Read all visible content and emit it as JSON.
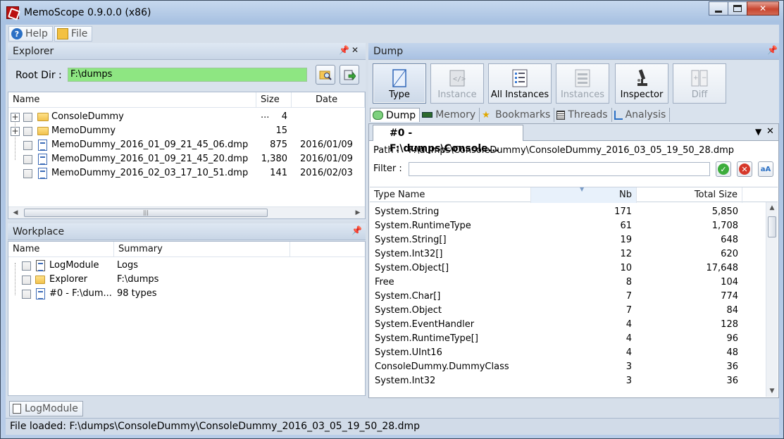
{
  "window": {
    "title": "MemoScope 0.9.0.0 (x86)"
  },
  "menu": {
    "help": "Help",
    "file": "File"
  },
  "explorer": {
    "title": "Explorer",
    "root_dir_label": "Root Dir :",
    "root_dir_value": "F:\\dumps",
    "columns": {
      "name": "Name",
      "size": "Size ...",
      "date": "Date"
    },
    "rows": [
      {
        "name": "ConsoleDummy",
        "size": "4",
        "date": "",
        "kind": "folder"
      },
      {
        "name": "MemoDummy",
        "size": "15",
        "date": "",
        "kind": "folder"
      },
      {
        "name": "MemoDummy_2016_01_09_21_45_06.dmp",
        "size": "875",
        "date": "2016/01/09",
        "kind": "file"
      },
      {
        "name": "MemoDummy_2016_01_09_21_45_20.dmp",
        "size": "1,380",
        "date": "2016/01/09",
        "kind": "file"
      },
      {
        "name": "MemoDummy_2016_02_03_17_10_51.dmp",
        "size": "141",
        "date": "2016/02/03",
        "kind": "file"
      }
    ]
  },
  "workplace": {
    "title": "Workplace",
    "columns": {
      "name": "Name",
      "summary": "Summary"
    },
    "rows": [
      {
        "name": "LogModule",
        "summary": "Logs"
      },
      {
        "name": "Explorer",
        "summary": "F:\\dumps"
      },
      {
        "name": "#0 - F:\\dum...",
        "summary": "98 types"
      }
    ]
  },
  "dump": {
    "title": "Dump",
    "toolbar": [
      "Type",
      "Instance",
      "All Instances",
      "Instances",
      "Inspector",
      "Diff"
    ],
    "tabs": [
      "Dump",
      "Memory",
      "Bookmarks",
      "Threads",
      "Analysis"
    ],
    "document_tab": "#0 - F:\\dumps\\Console...",
    "path_label": "Path :",
    "path_value": "F:\\dumps\\ConsoleDummy\\ConsoleDummy_2016_03_05_19_50_28.dmp",
    "filter_label": "Filter :",
    "filter_value": "",
    "columns": {
      "type_name": "Type Name",
      "nb": "Nb",
      "total_size": "Total Size"
    },
    "rows": [
      {
        "type": "System.String",
        "nb": "171",
        "size": "5,850"
      },
      {
        "type": "System.RuntimeType",
        "nb": "61",
        "size": "1,708"
      },
      {
        "type": "System.String[]",
        "nb": "19",
        "size": "648"
      },
      {
        "type": "System.Int32[]",
        "nb": "12",
        "size": "620"
      },
      {
        "type": "System.Object[]",
        "nb": "10",
        "size": "17,648"
      },
      {
        "type": "Free",
        "nb": "8",
        "size": "104"
      },
      {
        "type": "System.Char[]",
        "nb": "7",
        "size": "774"
      },
      {
        "type": "System.Object",
        "nb": "7",
        "size": "84"
      },
      {
        "type": "System.EventHandler",
        "nb": "4",
        "size": "128"
      },
      {
        "type": "System.RuntimeType[]",
        "nb": "4",
        "size": "96"
      },
      {
        "type": "System.UInt16",
        "nb": "4",
        "size": "48"
      },
      {
        "type": "ConsoleDummy.DummyClass",
        "nb": "3",
        "size": "36"
      },
      {
        "type": "System.Int32",
        "nb": "3",
        "size": "36"
      }
    ]
  },
  "bottom_tab": "LogModule",
  "status": "File loaded: F:\\dumps\\ConsoleDummy\\ConsoleDummy_2016_03_05_19_50_28.dmp"
}
